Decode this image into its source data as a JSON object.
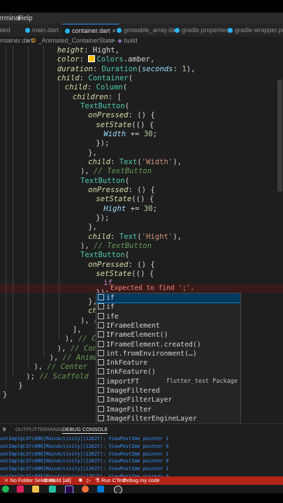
{
  "menu": [
    "Terminal",
    "Help"
  ],
  "tabs": [
    {
      "label": "ated",
      "active": false,
      "color": ""
    },
    {
      "label": "main.dart",
      "active": false,
      "color": "#29b6f6"
    },
    {
      "label": "container.dart",
      "active": true,
      "color": "#29b6f6",
      "close": "×"
    },
    {
      "label": "growable_array.dart",
      "active": false,
      "color": "#29b6f6"
    },
    {
      "label": "gradle.properties",
      "active": false,
      "color": "#29b6f6"
    },
    {
      "label": "gradle-wrapper.pe",
      "active": false,
      "color": "#29b6f6"
    }
  ],
  "breadcrumb": [
    "ontainer.dart",
    ">",
    "_Animated_ContainerState",
    ">",
    "build"
  ],
  "code": [
    {
      "indent": 14,
      "tokens": [
        {
          "t": "fld",
          "v": "height"
        },
        {
          "t": "plain",
          "v": ": Hight,"
        }
      ]
    },
    {
      "indent": 14,
      "tokens": [
        {
          "t": "fld",
          "v": "color"
        },
        {
          "t": "plain",
          "v": ": "
        },
        {
          "t": "swatch",
          "v": ""
        },
        {
          "t": "cls",
          "v": "Colors"
        },
        {
          "t": "plain",
          "v": ".amber,"
        }
      ]
    },
    {
      "indent": 14,
      "tokens": [
        {
          "t": "fld",
          "v": "duration"
        },
        {
          "t": "plain",
          "v": ": "
        },
        {
          "t": "cls",
          "v": "Duration"
        },
        {
          "t": "plain",
          "v": "("
        },
        {
          "t": "prm",
          "v": "seconds"
        },
        {
          "t": "plain",
          "v": ": "
        },
        {
          "t": "num",
          "v": "1"
        },
        {
          "t": "plain",
          "v": "),"
        }
      ]
    },
    {
      "indent": 14,
      "tokens": [
        {
          "t": "fld",
          "v": "child"
        },
        {
          "t": "plain",
          "v": ": "
        },
        {
          "t": "cls",
          "v": "Container"
        },
        {
          "t": "plain",
          "v": "("
        }
      ]
    },
    {
      "indent": 16,
      "tokens": [
        {
          "t": "fld",
          "v": "child"
        },
        {
          "t": "plain",
          "v": ": "
        },
        {
          "t": "cls",
          "v": "Column"
        },
        {
          "t": "plain",
          "v": "("
        }
      ]
    },
    {
      "indent": 18,
      "tokens": [
        {
          "t": "fld",
          "v": "children"
        },
        {
          "t": "plain",
          "v": ": ["
        }
      ]
    },
    {
      "indent": 20,
      "tokens": [
        {
          "t": "cls",
          "v": "TextButton"
        },
        {
          "t": "plain",
          "v": "("
        }
      ]
    },
    {
      "indent": 22,
      "tokens": [
        {
          "t": "fld",
          "v": "onPressed"
        },
        {
          "t": "plain",
          "v": ": () {"
        }
      ]
    },
    {
      "indent": 24,
      "tokens": [
        {
          "t": "fld",
          "v": "setState"
        },
        {
          "t": "plain",
          "v": "(() {"
        }
      ]
    },
    {
      "indent": 26,
      "tokens": [
        {
          "t": "prm",
          "v": "Width"
        },
        {
          "t": "plain",
          "v": " += "
        },
        {
          "t": "num",
          "v": "30"
        },
        {
          "t": "plain",
          "v": ";"
        }
      ]
    },
    {
      "indent": 24,
      "tokens": [
        {
          "t": "plain",
          "v": "});"
        }
      ]
    },
    {
      "indent": 22,
      "tokens": [
        {
          "t": "plain",
          "v": "},"
        }
      ]
    },
    {
      "indent": 22,
      "tokens": [
        {
          "t": "fld",
          "v": "child"
        },
        {
          "t": "plain",
          "v": ": "
        },
        {
          "t": "cls",
          "v": "Text"
        },
        {
          "t": "plain",
          "v": "("
        },
        {
          "t": "str",
          "v": "'Width'"
        },
        {
          "t": "plain",
          "v": "),"
        }
      ]
    },
    {
      "indent": 20,
      "tokens": [
        {
          "t": "plain",
          "v": "), "
        },
        {
          "t": "cmt",
          "v": "// TextButton"
        }
      ]
    },
    {
      "indent": 20,
      "tokens": [
        {
          "t": "cls",
          "v": "TextButton"
        },
        {
          "t": "plain",
          "v": "("
        }
      ]
    },
    {
      "indent": 22,
      "tokens": [
        {
          "t": "fld",
          "v": "onPressed"
        },
        {
          "t": "plain",
          "v": ": () {"
        }
      ]
    },
    {
      "indent": 24,
      "tokens": [
        {
          "t": "fld",
          "v": "setState"
        },
        {
          "t": "plain",
          "v": "(() {"
        }
      ]
    },
    {
      "indent": 26,
      "tokens": [
        {
          "t": "prm",
          "v": "Hight"
        },
        {
          "t": "plain",
          "v": " += "
        },
        {
          "t": "num",
          "v": "30"
        },
        {
          "t": "plain",
          "v": ";"
        }
      ]
    },
    {
      "indent": 24,
      "tokens": [
        {
          "t": "plain",
          "v": "});"
        }
      ]
    },
    {
      "indent": 22,
      "tokens": [
        {
          "t": "plain",
          "v": "},"
        }
      ]
    },
    {
      "indent": 22,
      "tokens": [
        {
          "t": "fld",
          "v": "child"
        },
        {
          "t": "plain",
          "v": ": "
        },
        {
          "t": "cls",
          "v": "Text"
        },
        {
          "t": "plain",
          "v": "("
        },
        {
          "t": "str",
          "v": "'Hight'"
        },
        {
          "t": "plain",
          "v": "),"
        }
      ]
    },
    {
      "indent": 20,
      "tokens": [
        {
          "t": "plain",
          "v": "), "
        },
        {
          "t": "cmt",
          "v": "// TextButton"
        }
      ]
    },
    {
      "indent": 20,
      "tokens": [
        {
          "t": "cls",
          "v": "TextButton"
        },
        {
          "t": "plain",
          "v": "("
        }
      ]
    },
    {
      "indent": 22,
      "tokens": [
        {
          "t": "fld",
          "v": "onPressed"
        },
        {
          "t": "plain",
          "v": ": () {"
        }
      ]
    },
    {
      "indent": 24,
      "tokens": [
        {
          "t": "fld",
          "v": "setState"
        },
        {
          "t": "plain",
          "v": "(() {"
        }
      ]
    },
    {
      "indent": 26,
      "tokens": [
        {
          "t": "kw",
          "v": "if"
        }
      ]
    },
    {
      "indent": 24,
      "tokens": [
        {
          "t": "plain",
          "v": "});"
        }
      ]
    },
    {
      "indent": 22,
      "tokens": [
        {
          "t": "plain",
          "v": "},"
        }
      ]
    },
    {
      "indent": 22,
      "tokens": [
        {
          "t": "fld",
          "v": "child"
        },
        {
          "t": "plain",
          "v": ":"
        }
      ]
    },
    {
      "indent": 20,
      "tokens": [
        {
          "t": "plain",
          "v": "), "
        },
        {
          "t": "cmt",
          "v": "// Te"
        }
      ]
    },
    {
      "indent": 18,
      "tokens": [
        {
          "t": "plain",
          "v": "],"
        }
      ]
    },
    {
      "indent": 16,
      "tokens": [
        {
          "t": "plain",
          "v": "), "
        },
        {
          "t": "cmt",
          "v": "// Column"
        }
      ]
    },
    {
      "indent": 14,
      "tokens": [
        {
          "t": "plain",
          "v": "), "
        },
        {
          "t": "cmt",
          "v": "// Containe"
        }
      ]
    },
    {
      "indent": 12,
      "tokens": [
        {
          "t": "plain",
          "v": "), "
        },
        {
          "t": "cmt",
          "v": "// AnimatedCo"
        }
      ]
    },
    {
      "indent": 8,
      "tokens": [
        {
          "t": "plain",
          "v": "), "
        },
        {
          "t": "cmt",
          "v": "// Center"
        }
      ]
    },
    {
      "indent": 6,
      "tokens": [
        {
          "t": "plain",
          "v": "); "
        },
        {
          "t": "cmt",
          "v": "// Scaffold"
        }
      ]
    },
    {
      "indent": 4,
      "tokens": [
        {
          "t": "plain",
          "v": "}"
        }
      ]
    },
    {
      "indent": 0,
      "tokens": [
        {
          "t": "plain",
          "v": "}"
        }
      ]
    }
  ],
  "error": {
    "message": "Expected to find ';'."
  },
  "suggestions": [
    {
      "label": "if",
      "detail": "",
      "selected": true
    },
    {
      "label": "if",
      "detail": "",
      "selected": false
    },
    {
      "label": "ife",
      "detail": "",
      "selected": false
    },
    {
      "label": "IFrameElement",
      "detail": "",
      "selected": false
    },
    {
      "label": "IFrameElement()",
      "detail": "",
      "selected": false
    },
    {
      "label": "IFrameElement.created()",
      "detail": "",
      "selected": false
    },
    {
      "label": "int.fromEnvironment(…)",
      "detail": "",
      "selected": false
    },
    {
      "label": "InkFeature",
      "detail": "",
      "selected": false
    },
    {
      "label": "InkFeature()",
      "detail": "",
      "selected": false
    },
    {
      "label": "importFT",
      "detail": "flutter_test Package",
      "selected": false
    },
    {
      "label": "ImageFiltered",
      "detail": "",
      "selected": false
    },
    {
      "label": "ImageFilterLayer",
      "detail": "",
      "selected": false
    },
    {
      "label": "ImageFilter",
      "detail": "",
      "selected": false
    },
    {
      "label": "ImageFilterEngineLayer",
      "detail": "",
      "selected": false
    }
  ],
  "panel": {
    "badge": "9",
    "tabs": [
      "OUTPUT",
      "TERMINAL",
      "DEBUG CONSOLE"
    ],
    "active_tab": "DEBUG CONSOLE",
    "logs": [
      "ootImpl@c3fc000[MainActivity](13627): ViewPostIme pointer 1",
      "ootImpl@c3fc000[MainActivity](13627): ViewPostIme pointer 0",
      "ootImpl@c3fc000[MainActivity](13627): ViewPostIme pointer 1",
      "ootImpl@c3fc000[MainActivity](13627): ViewPostIme pointer 0",
      "ootImpl@c3fc000[MainActivity](13627): ViewPostIme pointer 1",
      "ootImpl@c3fc000[MainActivity](13627): ViewPostIme pointer 0",
      "ootImpl@c3fc000[MainActivity](13627): ViewPostIme pointer 1"
    ]
  },
  "statusbar": {
    "no_folder": "No Folder Selected",
    "build": "Build",
    "all": "[all]",
    "run_ctest": "Run CTest",
    "debug": "Debug my code",
    "color": "#b42318"
  },
  "taskbar": [
    "spotify",
    "slack",
    "explorer",
    "vscode-insiders",
    "premiere",
    "firefox",
    "vscode",
    "obs"
  ]
}
